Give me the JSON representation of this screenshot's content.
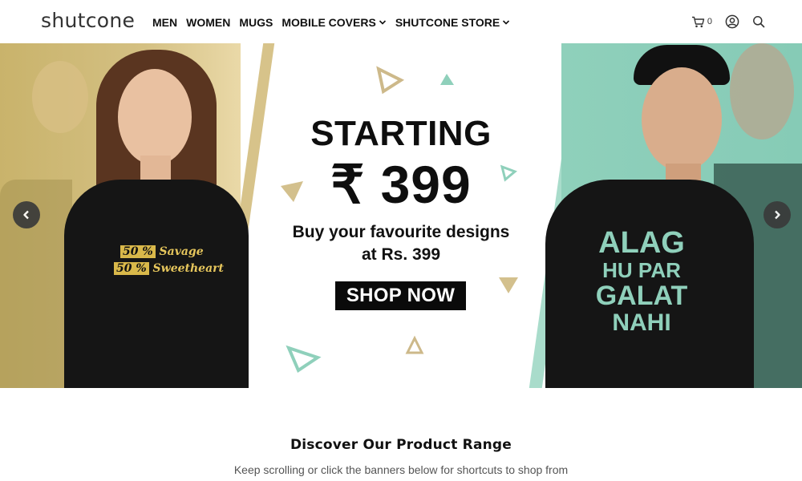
{
  "brand": {
    "logo": "shutcone"
  },
  "nav": {
    "items": [
      {
        "label": "MEN",
        "has_dropdown": false
      },
      {
        "label": "WOMEN",
        "has_dropdown": false
      },
      {
        "label": "MUGS",
        "has_dropdown": false
      },
      {
        "label": "MOBILE COVERS",
        "has_dropdown": true
      },
      {
        "label": "SHUTCONE STORE",
        "has_dropdown": true
      }
    ]
  },
  "header_icons": {
    "cart": {
      "icon": "cart-icon",
      "count": "0"
    },
    "account": {
      "icon": "user-circle-icon"
    },
    "search": {
      "icon": "search-icon"
    }
  },
  "hero": {
    "title": "STARTING",
    "price": "₹ 399",
    "subtitle_line1": "Buy your favourite designs",
    "subtitle_line2": "at Rs. 399",
    "cta": "SHOP NOW",
    "left_shirt_line1_pct": "50 %",
    "left_shirt_line1_word": "Savage",
    "left_shirt_line2_pct": "50 %",
    "left_shirt_line2_word": "Sweetheart",
    "right_shirt_lines": [
      "ALAG",
      "HU PAR",
      "GALAT",
      "NAHI"
    ],
    "prev_icon": "chevron-left-icon",
    "next_icon": "chevron-right-icon",
    "colors": {
      "gold": "#c9b36b",
      "mint": "#8fd0bb",
      "black": "#0a0a0a"
    }
  },
  "section": {
    "title": "Discover Our Product Range",
    "subtitle": "Keep scrolling or click the banners below for shortcuts to shop from"
  }
}
